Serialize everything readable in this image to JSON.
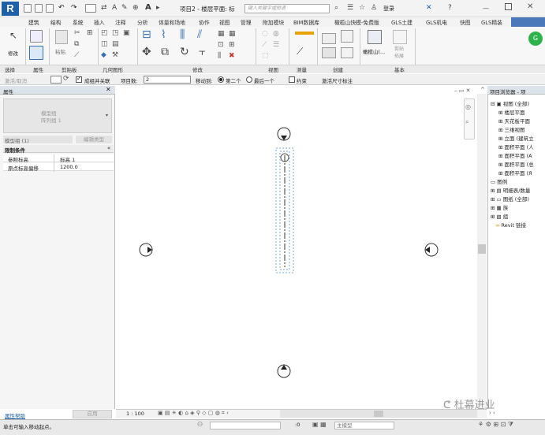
{
  "title_bar": {
    "app_logo": "R",
    "doc_title": "项目2 - 楼层平面: 标",
    "search_placeholder": "键入关键字或短语",
    "login_label": "登录"
  },
  "ribbon_tabs": [
    "建筑",
    "结构",
    "系统",
    "插入",
    "注释",
    "分析",
    "体量和场地",
    "协作",
    "视图",
    "管理",
    "附加模块",
    "BIM数据库",
    "橄榄山快模-免费版",
    "GLS土建",
    "GLS机电",
    "快图",
    "GLS精装"
  ],
  "ribbon_panels": {
    "select": "选择",
    "properties": "属性",
    "clipboard": "剪贴板",
    "geometry": "几何图形",
    "modify": "修改",
    "view": "视图",
    "measure": "测量",
    "create": "创建",
    "base": "基本"
  },
  "ribbon_buttons": {
    "modify": "修改",
    "paste": "粘贴",
    "olive_mountain": "橄榄山(...",
    "sheet_layout": "剪贴 拓展"
  },
  "options_bar": {
    "activate_deactivate": "激活/取消",
    "group_label": "成组并关联",
    "project_count_label": "项目数:",
    "project_count_value": "2",
    "move_to_label": "移动到:",
    "second": "第二个",
    "last": "最后一个",
    "constrain": "约束",
    "activate_dims": "激活尺寸标注"
  },
  "properties": {
    "title": "属性",
    "type_name": "模型组",
    "type_sub": "阵列组 1",
    "instance_label": "模型组 (1)",
    "edit_type": "编辑类型",
    "section": "限制条件",
    "rows": [
      {
        "name": "参照标高",
        "value": "标高 1"
      },
      {
        "name": "原点标高偏移",
        "value": "1200.0"
      }
    ],
    "help_link": "属性帮助",
    "apply": "应用"
  },
  "browser": {
    "title": "项目浏览器 - 项",
    "tree": [
      {
        "label": "视图 (全部)",
        "level": 0
      },
      {
        "label": "楼层平面",
        "level": 1
      },
      {
        "label": "天花板平面",
        "level": 1
      },
      {
        "label": "三维视图",
        "level": 1
      },
      {
        "label": "立面 (建筑立",
        "level": 1
      },
      {
        "label": "面积平面 (人",
        "level": 1
      },
      {
        "label": "面积平面 (A",
        "level": 1
      },
      {
        "label": "面积平面 (总",
        "level": 1
      },
      {
        "label": "面积平面 (Я",
        "level": 1
      },
      {
        "label": "图例",
        "level": 0
      },
      {
        "label": "明细表/数量",
        "level": 0
      },
      {
        "label": "图纸 (全部)",
        "level": 0
      },
      {
        "label": "族",
        "level": 0
      },
      {
        "label": "组",
        "level": 0
      },
      {
        "label": "Revit 链接",
        "level": 0
      }
    ]
  },
  "view_control": {
    "scale": "1 : 100"
  },
  "status_bar": {
    "message": "单击可输入移动起点。",
    "coord": ":0",
    "model_label": "主模型"
  },
  "watermark": "杜幕进业",
  "colors": {
    "accent": "#1d5fa8",
    "panel_head": "#dde3ea",
    "tab_dark": "#4a78b8"
  }
}
